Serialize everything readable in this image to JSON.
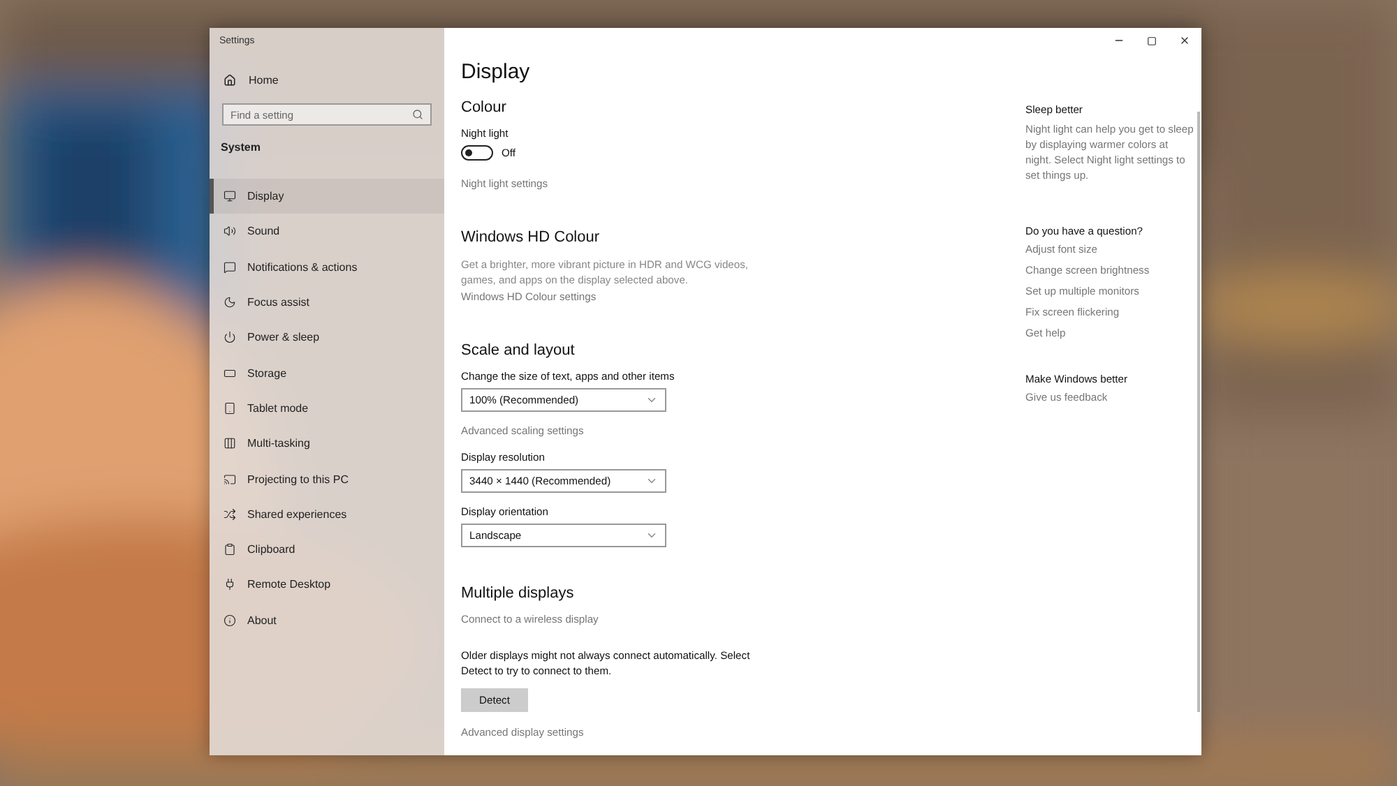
{
  "window": {
    "title": "Settings"
  },
  "sidebar": {
    "home": "Home",
    "search": {
      "placeholder": "Find a setting"
    },
    "section": "System",
    "items": [
      {
        "label": "Display",
        "selected": true
      },
      {
        "label": "Sound",
        "selected": false
      },
      {
        "label": "Notifications & actions",
        "selected": false
      },
      {
        "label": "Focus assist",
        "selected": false
      },
      {
        "label": "Power & sleep",
        "selected": false
      },
      {
        "label": "Storage",
        "selected": false
      },
      {
        "label": "Tablet mode",
        "selected": false
      },
      {
        "label": "Multi-tasking",
        "selected": false
      },
      {
        "label": "Projecting to this PC",
        "selected": false
      },
      {
        "label": "Shared experiences",
        "selected": false
      },
      {
        "label": "Clipboard",
        "selected": false
      },
      {
        "label": "Remote Desktop",
        "selected": false
      },
      {
        "label": "About",
        "selected": false
      }
    ]
  },
  "page": {
    "title": "Display",
    "sections": [
      {
        "heading": "Colour",
        "items": [
          {
            "kind": "label",
            "text": "Night light"
          },
          {
            "kind": "toggle",
            "on": false,
            "text": "Off"
          },
          {
            "kind": "link",
            "text": "Night light settings"
          }
        ]
      },
      {
        "heading": "Windows HD Colour",
        "items": [
          {
            "kind": "description",
            "text": "Get a brighter, more vibrant picture in HDR and WCG videos, games, and apps on the display selected above."
          },
          {
            "kind": "link",
            "text": "Windows HD Colour settings"
          }
        ]
      },
      {
        "heading": "Scale and layout",
        "items": [
          {
            "kind": "label",
            "text": "Change the size of text, apps and other items"
          },
          {
            "kind": "dropdown",
            "text": "100% (Recommended)"
          },
          {
            "kind": "link",
            "text": "Advanced scaling settings"
          },
          {
            "kind": "label",
            "text": "Display resolution"
          },
          {
            "kind": "dropdown",
            "text": "3440 × 1440 (Recommended)"
          },
          {
            "kind": "label",
            "text": "Display orientation"
          },
          {
            "kind": "dropdown",
            "text": "Landscape"
          }
        ]
      },
      {
        "heading": "Multiple displays",
        "items": [
          {
            "kind": "link",
            "text": "Connect to a wireless display"
          },
          {
            "kind": "text",
            "text": "Older displays might not always connect automatically. Select Detect to try to connect to them."
          },
          {
            "kind": "button",
            "text": "Detect"
          },
          {
            "kind": "link",
            "text": "Advanced display settings"
          }
        ]
      }
    ]
  },
  "aside": [
    {
      "heading": "Sleep better",
      "text": "Night light can help you get to sleep by displaying warmer colors at night. Select Night light settings to set things up."
    },
    {
      "heading": "Do you have a question?",
      "links": [
        "Adjust font size",
        "Change screen brightness",
        "Set up multiple monitors",
        "Fix screen flickering",
        "Get help"
      ]
    },
    {
      "heading": "Make Windows better",
      "links": [
        "Give us feedback"
      ]
    }
  ]
}
